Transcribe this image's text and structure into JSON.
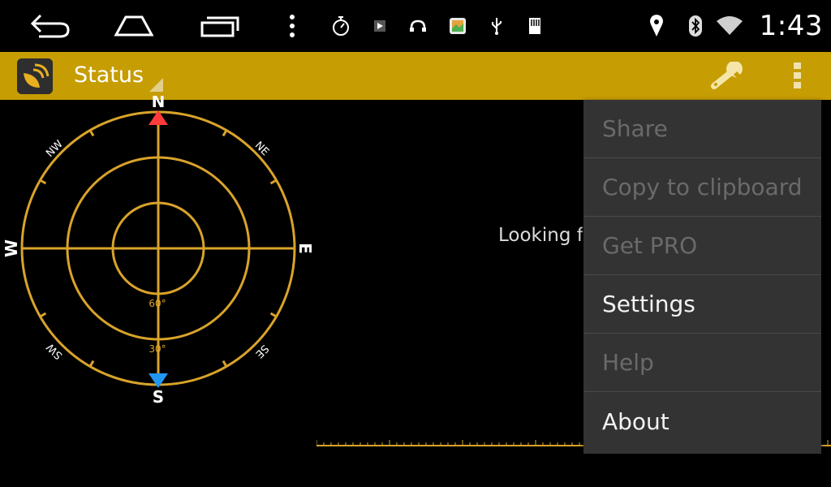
{
  "status_bar": {
    "clock": "1:43",
    "icons": [
      "back-icon",
      "home-icon",
      "recent-apps-icon",
      "more-vert-icon",
      "stopwatch-icon",
      "media-play-icon",
      "headset-icon",
      "gallery-icon",
      "usb-icon",
      "sd-card-icon",
      "location-pin-icon",
      "bluetooth-icon",
      "wifi-icon"
    ]
  },
  "action_bar": {
    "title": "Status",
    "color": "#c69d03",
    "actions": [
      "wrench-icon",
      "overflow-menu-icon"
    ]
  },
  "compass": {
    "labels": {
      "n": "N",
      "s": "S",
      "e": "E",
      "w": "W",
      "ne": "NE",
      "nw": "NW",
      "se": "SE",
      "sw": "SW"
    },
    "elevation_labels": {
      "inner": "60°",
      "middle": "30°"
    },
    "ring_color": "#d9a32a"
  },
  "main": {
    "status_text": "Looking for"
  },
  "menu": {
    "items": [
      {
        "label": "Share",
        "enabled": false
      },
      {
        "label": "Copy to clipboard",
        "enabled": false
      },
      {
        "label": "Get PRO",
        "enabled": false
      },
      {
        "label": "Settings",
        "enabled": true
      },
      {
        "label": "Help",
        "enabled": false
      },
      {
        "label": "About",
        "enabled": true
      }
    ]
  }
}
